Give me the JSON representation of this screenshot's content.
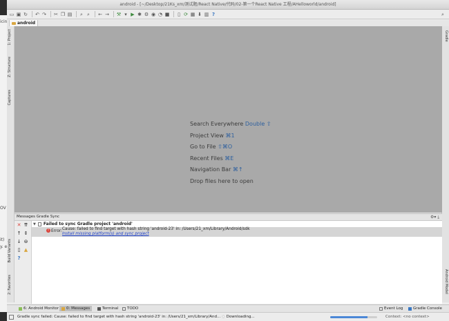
{
  "window": {
    "title": "android - [~/Desktop/21Ks_xm/测试题/React Native/代码/02-第一个React Native 工程/AHelloworld/android]"
  },
  "backdrop": {
    "side_text_1": "icin",
    "side_text_2": "OV",
    "side_text_3": "it)",
    "side_text_4": "y. e"
  },
  "navbar": {
    "crumb": "android"
  },
  "left_tabs": {
    "project": "1: Project",
    "structure": "Z: Structure",
    "captures": "Captures",
    "build_variants": "Build Variants",
    "favorites": "2: Favorites"
  },
  "right_tabs": {
    "gradle": "Gradle",
    "android_model": "Android Model"
  },
  "hints": [
    {
      "text": "Search Everywhere",
      "shortcut": "Double ⇧"
    },
    {
      "text": "Project View",
      "shortcut": "⌘1"
    },
    {
      "text": "Go to File",
      "shortcut": "⇧⌘O"
    },
    {
      "text": "Recent Files",
      "shortcut": "⌘E"
    },
    {
      "text": "Navigation Bar",
      "shortcut": "⌘↑"
    },
    {
      "text": "Drop files here to open",
      "shortcut": ""
    }
  ],
  "messages": {
    "header": "Messages Gradle Sync",
    "group": "Failed to sync Gradle project 'android'",
    "error_label": "Error:",
    "error_text": "Cause: failed to find target with hash string 'android-23' in: /Users/21_xm/Library/Android/sdk",
    "error_link": "Install missing platform(s) and sync project"
  },
  "bottom_tabs": {
    "android_monitor": "6: Android Monitor",
    "messages": "0: Messages",
    "terminal": "Terminal",
    "todo": "TODO",
    "event_log": "Event Log",
    "gradle_console": "Gradle Console"
  },
  "status": {
    "message": "Gradle sync failed: Cause: failed to find target with hash string 'android-23' in: /Users/21_xm/Library/And...",
    "downloading": "Downloading...",
    "context": "Context: <no context>",
    "progress": 0.8
  }
}
